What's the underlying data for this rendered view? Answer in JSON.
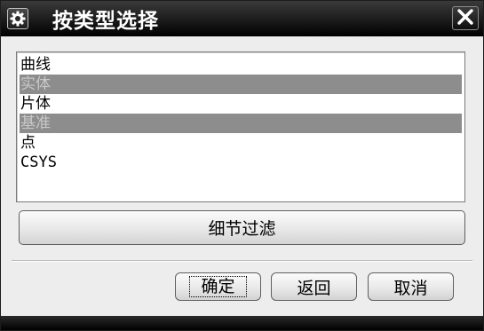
{
  "window": {
    "title": "按类型选择",
    "title_icon": "gear-icon",
    "close_icon": "close-icon"
  },
  "type_list": {
    "items": [
      {
        "label": "曲线",
        "selected": false
      },
      {
        "label": "实体",
        "selected": true
      },
      {
        "label": "片体",
        "selected": false
      },
      {
        "label": "基准",
        "selected": true
      },
      {
        "label": "点",
        "selected": false
      },
      {
        "label": "CSYS",
        "selected": false
      }
    ]
  },
  "filter_button": {
    "label": "细节过滤"
  },
  "buttons": {
    "ok": "确定",
    "back": "返回",
    "cancel": "取消"
  },
  "colors": {
    "titlebar": "#000000",
    "dialog_bg": "#ededed",
    "selection_bg": "#8d8d8d",
    "selection_text": "#c8c8c8"
  }
}
